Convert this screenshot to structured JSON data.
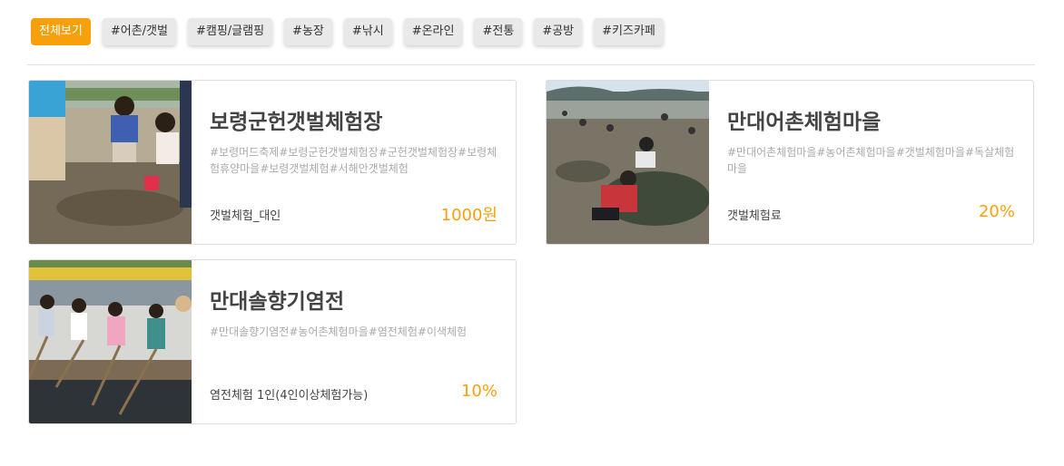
{
  "filters": [
    {
      "label": "전체보기",
      "active": true
    },
    {
      "label": "#어촌/갯벌",
      "active": false
    },
    {
      "label": "#캠핑/글램핑",
      "active": false
    },
    {
      "label": "#농장",
      "active": false
    },
    {
      "label": "#낚시",
      "active": false
    },
    {
      "label": "#온라인",
      "active": false
    },
    {
      "label": "#전통",
      "active": false
    },
    {
      "label": "#공방",
      "active": false
    },
    {
      "label": "#키즈카페",
      "active": false
    }
  ],
  "cards": [
    {
      "title": "보령군헌갯벌체험장",
      "tags": "#보령머드축제#보령군헌갯벌체험장#군헌갯벌체험장#보령체험휴양마을#보령갯벌체험#서해안갯벌체험",
      "item": "갯벌체험_대인",
      "price": "1000원"
    },
    {
      "title": "만대어촌체험마을",
      "tags": "#만대어촌체험마을#농어촌체험마을#갯벌체험마을#독살체험마을",
      "item": "갯벌체험료",
      "price": "20%"
    },
    {
      "title": "만대솔향기염전",
      "tags": "#만대솔향기염전#농어촌체험마을#염전체험#이색체험",
      "item": "염전체험 1인(4인이상체험가능)",
      "price": "10%"
    }
  ],
  "colors": {
    "accent": "#f7a00c",
    "chip_bg": "#e9e9e9"
  }
}
